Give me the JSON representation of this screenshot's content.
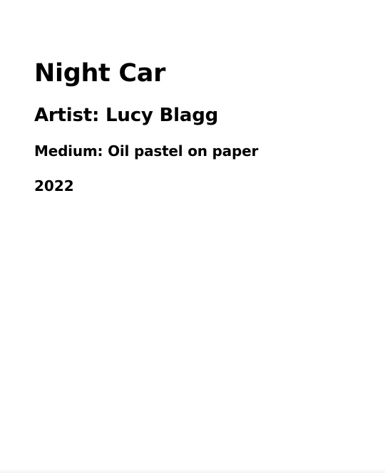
{
  "artwork": {
    "title": "Night Car",
    "artist": "Artist: Lucy Blagg",
    "medium": "Medium: Oil pastel on paper",
    "year": "2022"
  },
  "colors": {
    "background": "#ffffff",
    "text": "#000000"
  }
}
